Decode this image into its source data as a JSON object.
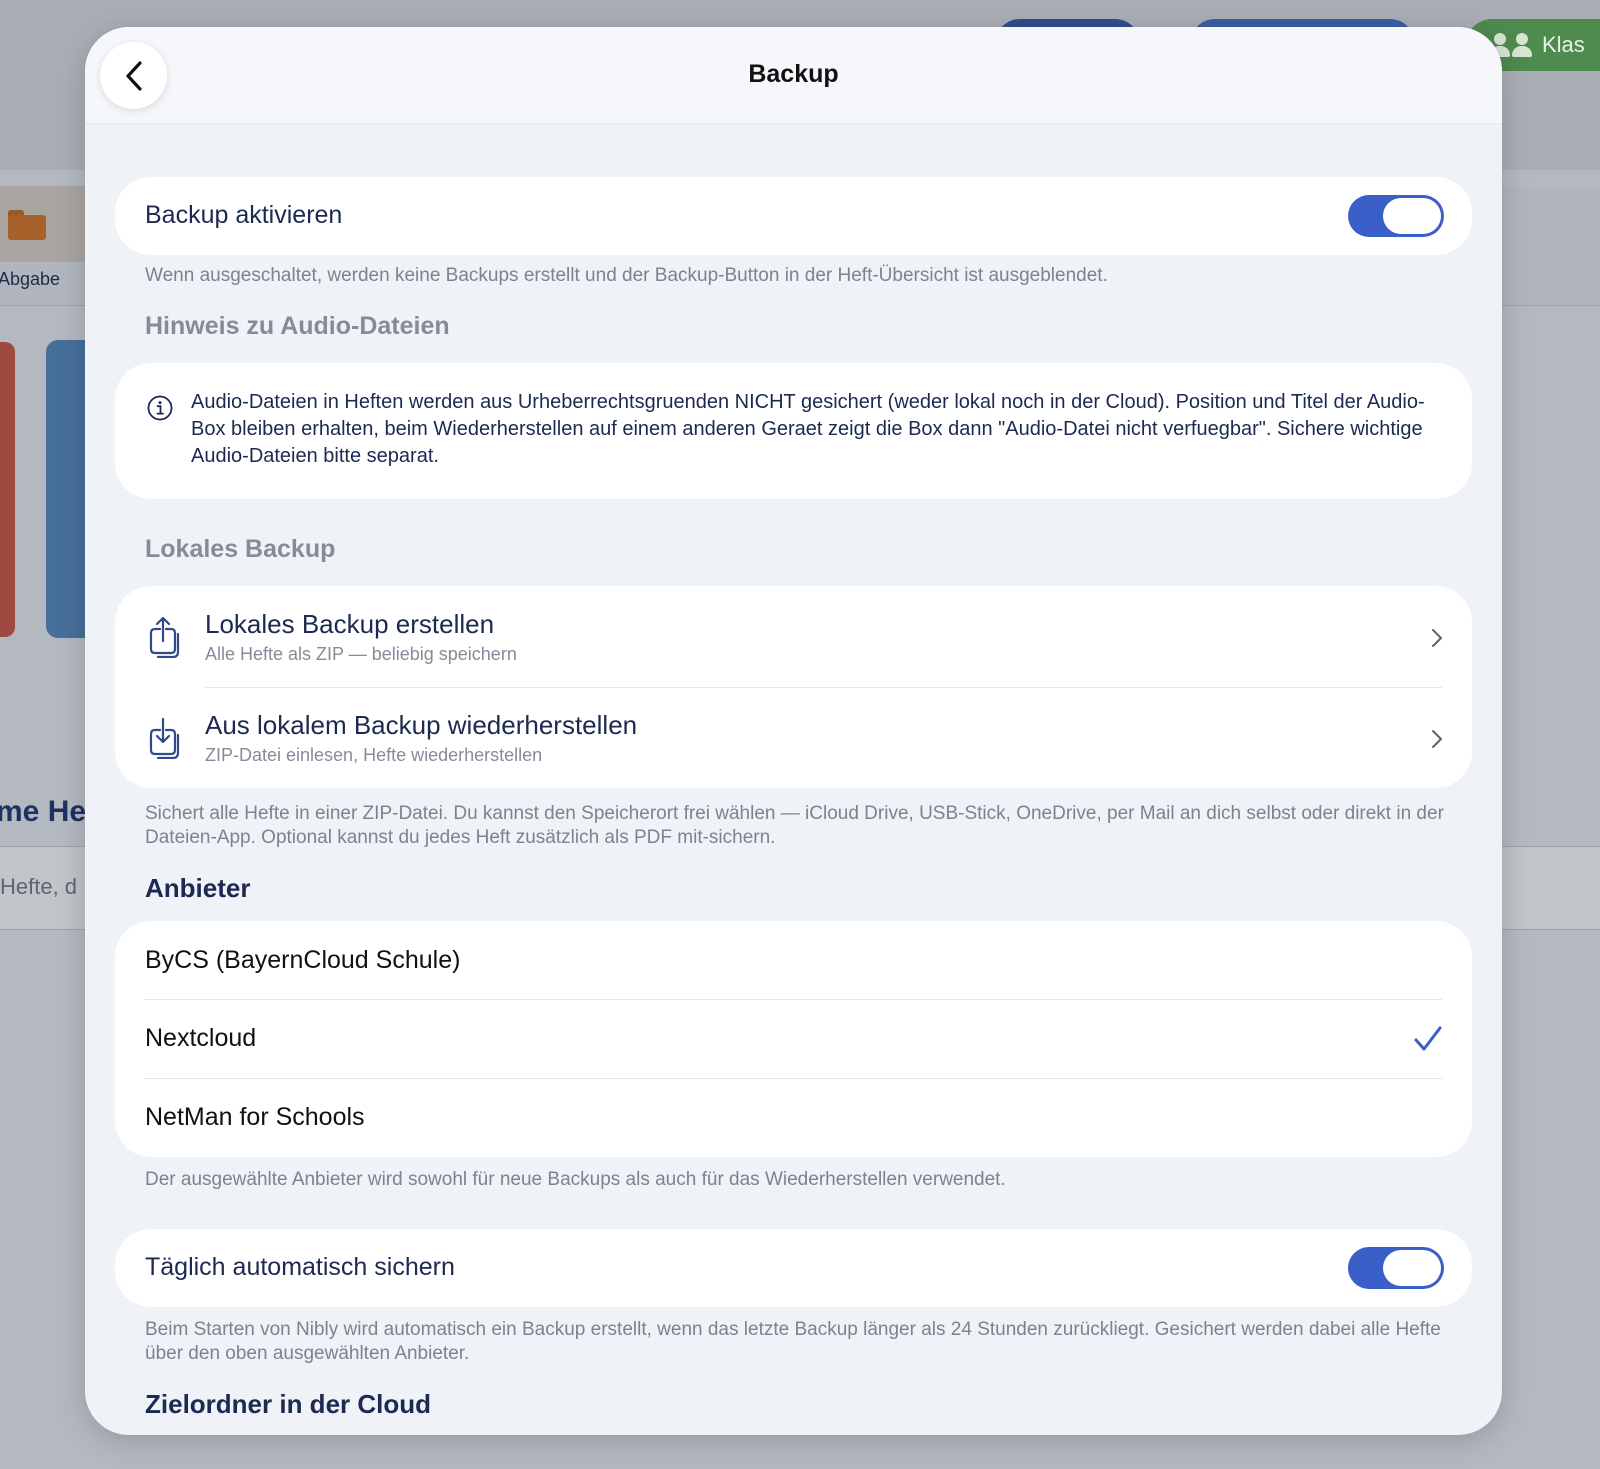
{
  "background": {
    "top_button": "Klas",
    "folder_label": "Abgabe",
    "heading_fragment": "me Hef",
    "search_fragment": "Hefte, d"
  },
  "header": {
    "title": "Backup"
  },
  "backup_toggle": {
    "label": "Backup aktivieren",
    "enabled": true,
    "footnote": "Wenn ausgeschaltet, werden keine Backups erstellt und der Backup-Button in der Heft-Übersicht ist ausgeblendet."
  },
  "audio_notice": {
    "heading": "Hinweis zu Audio-Dateien",
    "text": "Audio-Dateien in Heften werden aus Urheberrechtsgruenden NICHT gesichert (weder lokal noch in der Cloud). Position und Titel der Audio-Box bleiben erhalten, beim Wiederherstellen auf einem anderen Geraet zeigt die Box dann \"Audio-Datei nicht verfuegbar\". Sichere wichtige Audio-Dateien bitte separat."
  },
  "local_backup": {
    "heading": "Lokales Backup",
    "items": [
      {
        "title": "Lokales Backup erstellen",
        "subtitle": "Alle Hefte als ZIP — beliebig speichern",
        "icon": "share-upload-icon"
      },
      {
        "title": "Aus lokalem Backup wiederherstellen",
        "subtitle": "ZIP-Datei einlesen, Hefte wiederherstellen",
        "icon": "download-restore-icon"
      }
    ],
    "footnote": "Sichert alle Hefte in einer ZIP-Datei. Du kannst den Speicherort frei wählen — iCloud Drive, USB-Stick, OneDrive, per Mail an dich selbst oder direkt in der Dateien-App. Optional kannst du jedes Heft zusätzlich als PDF mit-sichern."
  },
  "providers": {
    "heading": "Anbieter",
    "items": [
      {
        "label": "ByCS (BayernCloud Schule)",
        "selected": false
      },
      {
        "label": "Nextcloud",
        "selected": true
      },
      {
        "label": "NetMan for Schools",
        "selected": false
      }
    ],
    "footnote": "Der ausgewählte Anbieter wird sowohl für neue Backups als auch für das Wiederherstellen verwendet."
  },
  "daily_backup": {
    "label": "Täglich automatisch sichern",
    "enabled": true,
    "footnote": "Beim Starten von Nibly wird automatisch ein Backup erstellt, wenn das letzte Backup länger als 24 Stunden zurückliegt. Gesichert werden dabei alle Hefte über den oben ausgewählten Anbieter."
  },
  "target_folder": {
    "heading": "Zielordner in der Cloud"
  },
  "colors": {
    "accent": "#3a5fc9",
    "text_primary": "#1c2a52",
    "text_secondary": "#858b97",
    "sheet_background": "#eff2f7",
    "background_button_green": "#4f8a4f"
  }
}
